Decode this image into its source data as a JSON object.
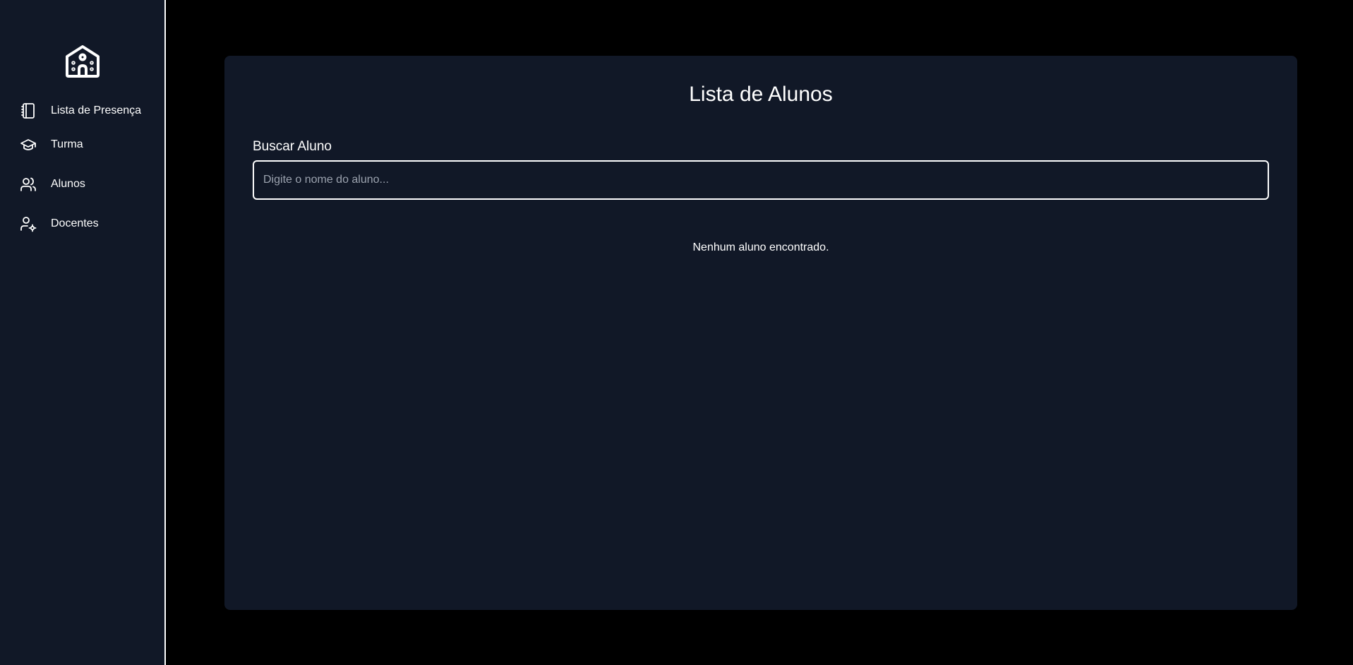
{
  "sidebar": {
    "logo_icon": "school-building-icon",
    "items": [
      {
        "label": "Lista de Presença",
        "icon": "notebook-icon"
      },
      {
        "label": "Turma",
        "icon": "graduation-cap-icon"
      },
      {
        "label": "Alunos",
        "icon": "users-icon"
      },
      {
        "label": "Docentes",
        "icon": "user-gear-icon"
      }
    ]
  },
  "main": {
    "title": "Lista de Alunos",
    "search": {
      "label": "Buscar Aluno",
      "placeholder": "Digite o nome do aluno...",
      "value": ""
    },
    "empty_message": "Nenhum aluno encontrado."
  },
  "colors": {
    "page_background": "#000000",
    "panel_background": "#111827",
    "text": "#ffffff",
    "placeholder": "#9ca3af",
    "border": "#ffffff"
  }
}
